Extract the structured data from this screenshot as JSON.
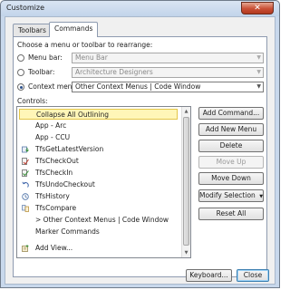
{
  "window": {
    "title": "Customize",
    "close_glyph": "✕"
  },
  "tabs": [
    {
      "label": "Toolbars",
      "active": false
    },
    {
      "label": "Commands",
      "active": true
    }
  ],
  "panel": {
    "instruction": "Choose a menu or toolbar to rearrange:",
    "menu_bar": {
      "label": "Menu bar:",
      "value": "Menu Bar",
      "selected": false
    },
    "toolbar": {
      "label": "Toolbar:",
      "value": "Architecture Designers",
      "selected": false
    },
    "context_menu": {
      "label": "Context menu:",
      "value": "Other Context Menus | Code Window",
      "selected": true
    },
    "controls_label": "Controls:"
  },
  "controls": [
    {
      "label": "Collapse All Outlining",
      "icon": "none",
      "selected": true
    },
    {
      "label": "App - Arc",
      "icon": "none"
    },
    {
      "label": "App - CCU",
      "icon": "none"
    },
    {
      "label": "TfsGetLatestVersion",
      "icon": "get-latest-icon"
    },
    {
      "label": "TfsCheckOut",
      "icon": "checkout-icon"
    },
    {
      "label": "TfsCheckIn",
      "icon": "checkin-icon"
    },
    {
      "label": "TfsUndoCheckout",
      "icon": "undo-icon"
    },
    {
      "label": "TfsHistory",
      "icon": "history-icon"
    },
    {
      "label": "TfsCompare",
      "icon": "compare-icon"
    },
    {
      "label": "> Other Context Menus | Code Window",
      "icon": "none"
    },
    {
      "label": "Marker Commands",
      "icon": "none"
    },
    {
      "label": "Add View...",
      "icon": "add-view-icon"
    }
  ],
  "buttons": {
    "add_command": "Add Command...",
    "add_new_menu": "Add New Menu",
    "delete": "Delete",
    "move_up": "Move Up",
    "move_down": "Move Down",
    "modify_selection": "Modify Selection",
    "reset_all": "Reset All",
    "keyboard": "Keyboard...",
    "close": "Close"
  },
  "colors": {
    "selection_fill": "#fff6b8",
    "selection_border": "#e3c64a",
    "window_frame": "#c8d8ec",
    "close_button": "#c94f35"
  }
}
